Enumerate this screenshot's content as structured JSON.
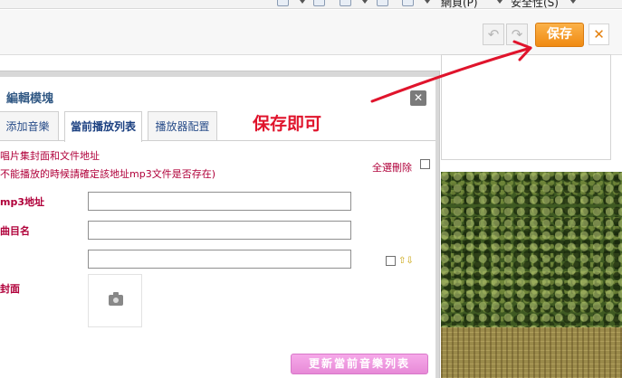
{
  "browser_toolbar": {
    "page_menu": "網頁(P)",
    "safety_menu": "安全性(S)"
  },
  "editor_toolbar": {
    "undo_icon": "undo-icon",
    "redo_icon": "redo-icon",
    "save_label": "保存",
    "close_glyph": "✕"
  },
  "dialog": {
    "title": "編輯模塊",
    "close_glyph": "✕",
    "tabs": [
      {
        "label": "添加音樂",
        "active": false
      },
      {
        "label": "當前播放列表",
        "active": true
      },
      {
        "label": "播放器配置",
        "active": false
      }
    ],
    "description_line1": "唱片集封面和文件地址",
    "description_line2": "不能播放的時候請確定該地址mp3文件是否存在)",
    "select_all_delete": "全選刪除",
    "fields": {
      "mp3_url_label": "mp3地址",
      "mp3_url_value": "",
      "song_name_label": "曲目名",
      "song_name_value": "",
      "third_value": "",
      "cover_label": "封面"
    },
    "reorder_arrows": "⇧⇩",
    "update_button": "更新當前音樂列表"
  },
  "annotation": {
    "text": "保存即可",
    "color": "#e0142c"
  },
  "colors": {
    "save_orange": "#f08a12",
    "label_red": "#b0003a",
    "tab_blue": "#2a4e8a",
    "update_pink": "#e78ad7"
  }
}
